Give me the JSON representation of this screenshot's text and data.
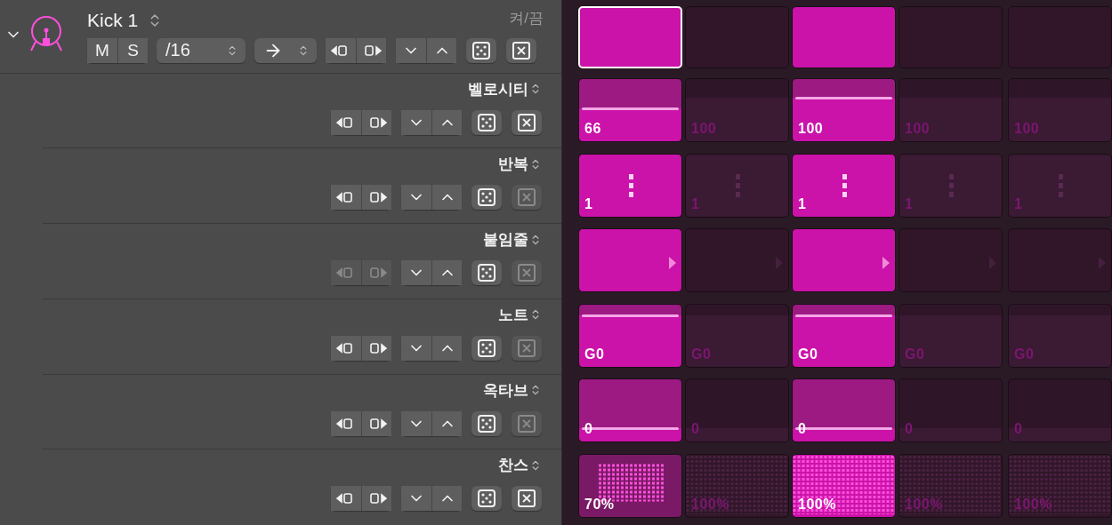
{
  "track": {
    "name": "Kick 1",
    "expanded": true,
    "on_off_label": "켜/끔",
    "mute": "M",
    "solo": "S",
    "rate": "/16",
    "shift_enabled": true,
    "clear_enabled": true
  },
  "steps": [
    {
      "on": true,
      "selected": true
    },
    {
      "on": false,
      "selected": false
    },
    {
      "on": true,
      "selected": false
    },
    {
      "on": false,
      "selected": false
    },
    {
      "on": false,
      "selected": false
    }
  ],
  "rows": [
    {
      "label": "벨로시티",
      "kind": "velocity",
      "shift_enabled": true,
      "clear_enabled": true,
      "cells": [
        {
          "value": "66"
        },
        {
          "value": "100"
        },
        {
          "value": "100"
        },
        {
          "value": "100"
        },
        {
          "value": "100"
        }
      ]
    },
    {
      "label": "반복",
      "kind": "repeat",
      "shift_enabled": true,
      "clear_enabled": false,
      "cells": [
        {
          "value": "1"
        },
        {
          "value": "1"
        },
        {
          "value": "1"
        },
        {
          "value": "1"
        },
        {
          "value": "1"
        }
      ]
    },
    {
      "label": "붙임줄",
      "kind": "tie",
      "shift_enabled": false,
      "clear_enabled": false,
      "cells": [
        {},
        {},
        {},
        {},
        {}
      ]
    },
    {
      "label": "노트",
      "kind": "note",
      "shift_enabled": true,
      "clear_enabled": false,
      "cells": [
        {
          "value": "G0"
        },
        {
          "value": "G0"
        },
        {
          "value": "G0"
        },
        {
          "value": "G0"
        },
        {
          "value": "G0"
        }
      ]
    },
    {
      "label": "옥타브",
      "kind": "octave",
      "shift_enabled": true,
      "clear_enabled": false,
      "cells": [
        {
          "value": "0"
        },
        {
          "value": "0"
        },
        {
          "value": "0"
        },
        {
          "value": "0"
        },
        {
          "value": "0"
        }
      ]
    },
    {
      "label": "찬스",
      "kind": "chance",
      "shift_enabled": true,
      "clear_enabled": true,
      "cells": [
        {
          "value": "70%"
        },
        {
          "value": "100%"
        },
        {
          "value": "100%"
        },
        {
          "value": "100%"
        },
        {
          "value": "100%"
        }
      ]
    }
  ]
}
